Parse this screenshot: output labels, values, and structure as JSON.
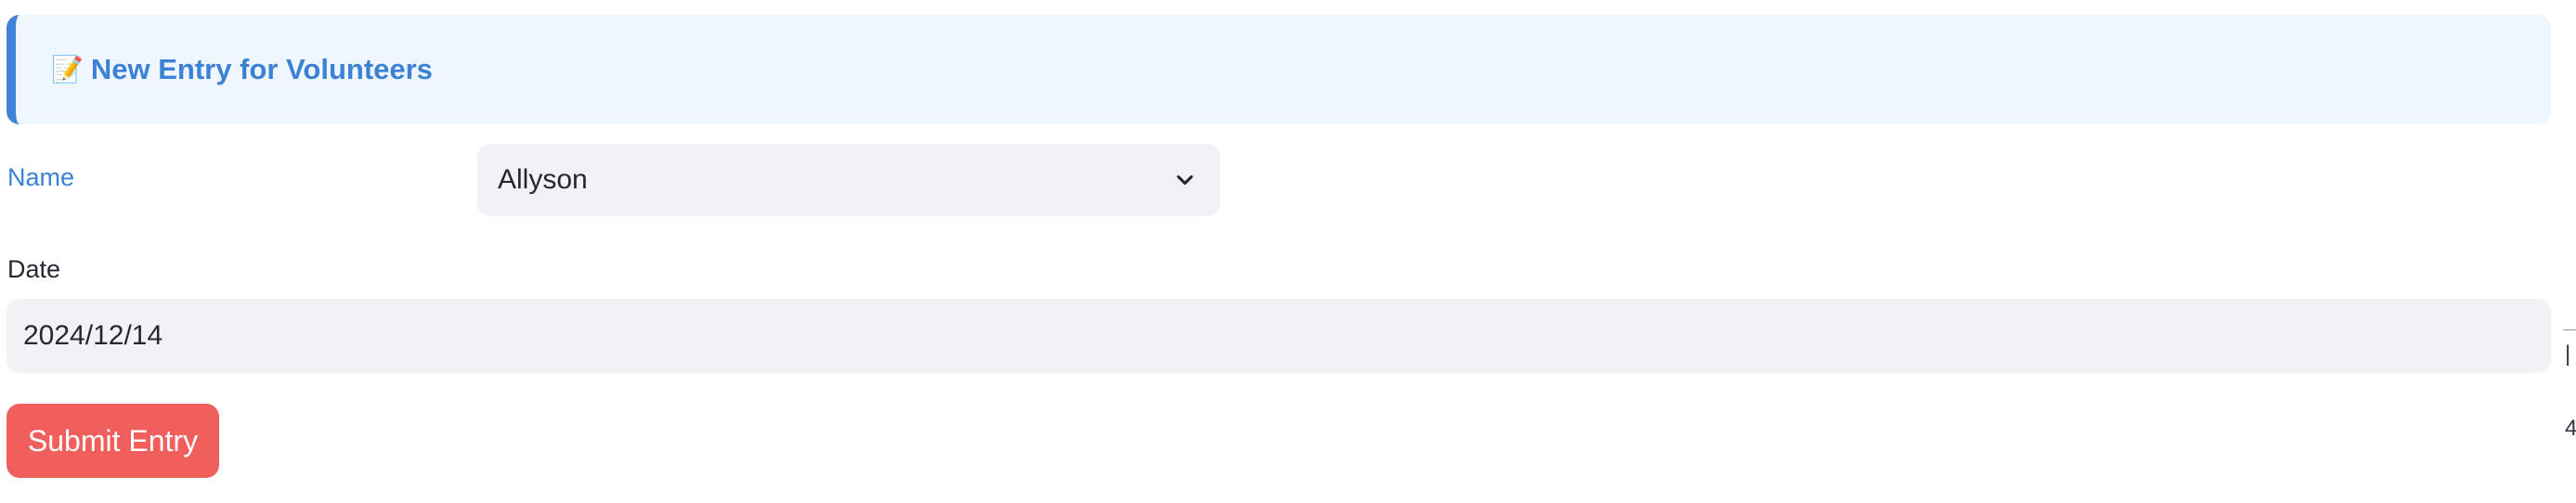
{
  "header": {
    "icon": "memo-icon",
    "icon_glyph": "📝",
    "title": "New Entry for Volunteers"
  },
  "form": {
    "name_label": "Name",
    "name_value": "Allyson",
    "date_label": "Date",
    "date_value": "2024/12/14",
    "submit_label": "Submit Entry"
  },
  "edge_fragments": {
    "top": "|",
    "bottom": "4"
  },
  "colors": {
    "accent": "#3b81d6",
    "header_bg": "#f0f6fd",
    "input_bg": "#f0f2f6",
    "button": "#f05f5b"
  }
}
